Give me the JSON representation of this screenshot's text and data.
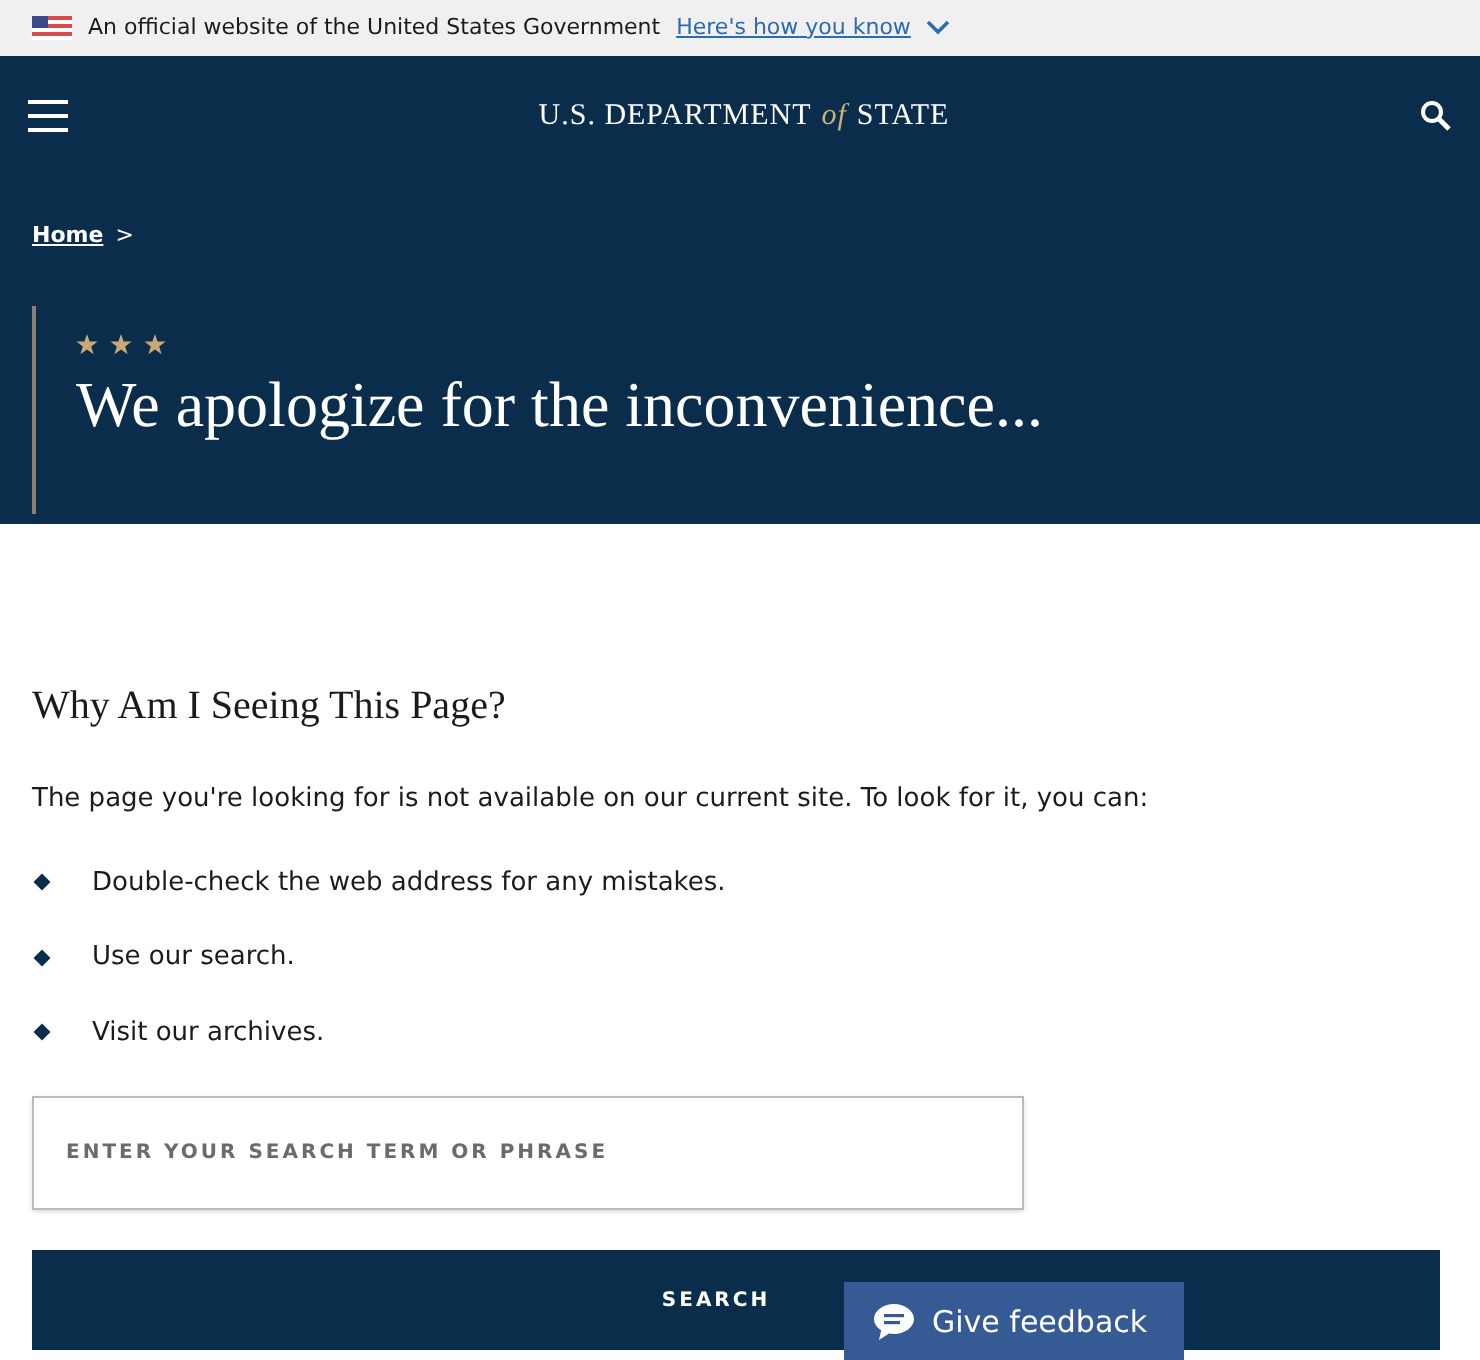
{
  "gov_banner": {
    "text": "An official website of the United States Government",
    "link": "Here's how you know"
  },
  "header": {
    "logo_text": "U.S. DEPARTMENT",
    "logo_of": "of",
    "logo_tail": "STATE"
  },
  "breadcrumb": {
    "link": "Home",
    "separator": ">"
  },
  "hero": {
    "title": "We apologize for the inconvenience..."
  },
  "content": {
    "heading": "Why Am I Seeing This Page?",
    "intro": "The page you're looking for is not available on our current site. To look for it, you can:",
    "list": [
      "Double-check the web address for any mistakes.",
      "Use our search.",
      "Visit our archives."
    ]
  },
  "search": {
    "placeholder": "ENTER YOUR SEARCH TERM OR PHRASE",
    "button": "SEARCH"
  },
  "feedback": {
    "label": "Give feedback"
  }
}
